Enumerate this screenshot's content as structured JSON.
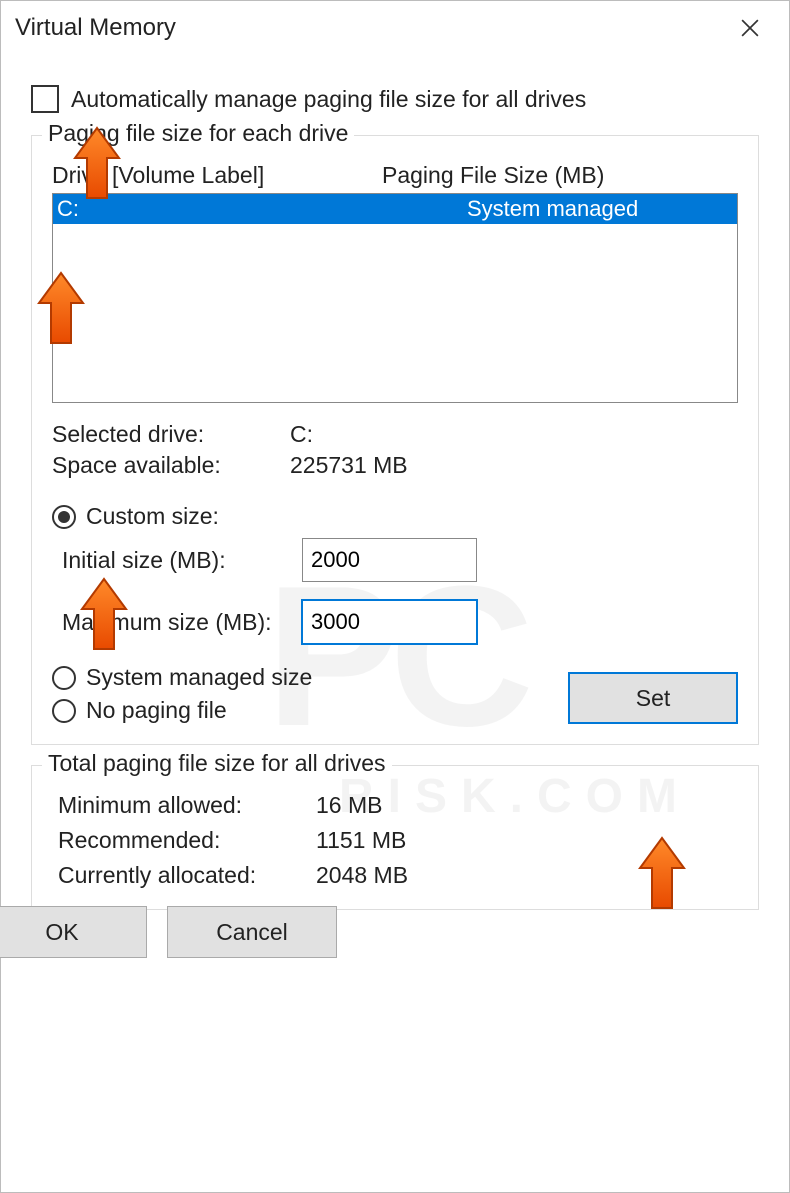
{
  "window": {
    "title": "Virtual Memory"
  },
  "checkbox": {
    "label": "Automatically manage paging file size for all drives",
    "checked": false
  },
  "group1": {
    "legend": "Paging file size for each drive",
    "header_drive": "Drive  [Volume Label]",
    "header_size": "Paging File Size (MB)",
    "rows": [
      {
        "drive": "C:",
        "size": "System managed",
        "selected": true
      }
    ],
    "selected_drive_label": "Selected drive:",
    "selected_drive_value": "C:",
    "space_label": "Space available:",
    "space_value": "225731 MB",
    "radio_custom": "Custom size:",
    "initial_label": "Initial size (MB):",
    "initial_value": "2000",
    "max_label": "Maximum size (MB):",
    "max_value": "3000",
    "radio_system": "System managed size",
    "radio_none": "No paging file",
    "set_btn": "Set"
  },
  "group2": {
    "legend": "Total paging file size for all drives",
    "min_label": "Minimum allowed:",
    "min_value": "16 MB",
    "rec_label": "Recommended:",
    "rec_value": "1151 MB",
    "cur_label": "Currently allocated:",
    "cur_value": "2048 MB"
  },
  "buttons": {
    "ok": "OK",
    "cancel": "Cancel"
  },
  "selected_size_option": "custom"
}
